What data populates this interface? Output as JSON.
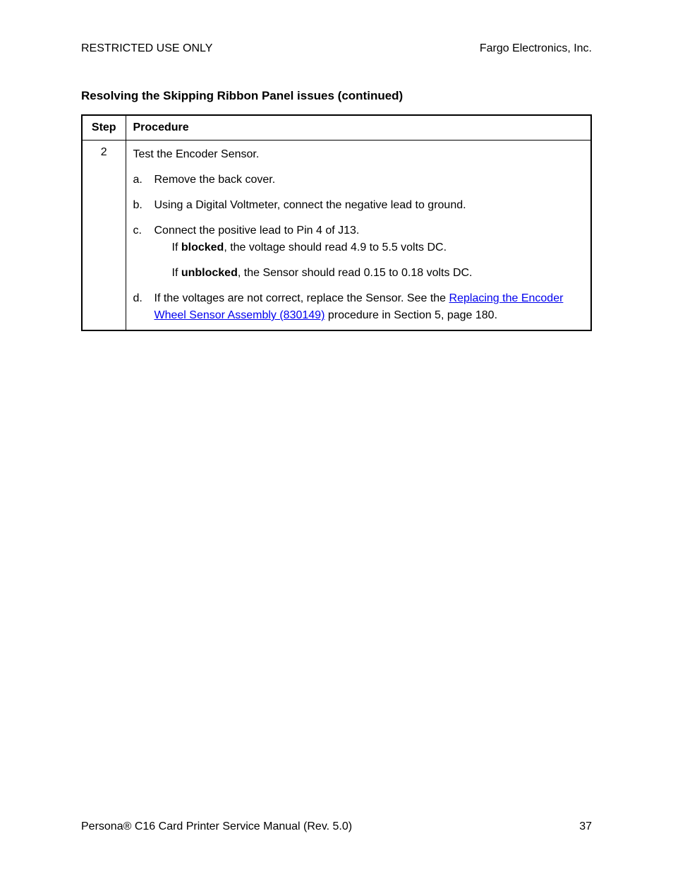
{
  "header": {
    "left": "RESTRICTED USE ONLY",
    "right": "Fargo Electronics, Inc."
  },
  "section_title": "Resolving the Skipping Ribbon Panel issues (continued)",
  "table": {
    "col_step": "Step",
    "col_procedure": "Procedure",
    "step_num": "2",
    "intro": "Test the Encoder Sensor.",
    "a_marker": "a.",
    "a_text": "Remove the back cover.",
    "b_marker": "b.",
    "b_text": "Using a Digital Voltmeter, connect the negative lead to ground.",
    "c_marker": "c.",
    "c_text": "Connect the positive lead to Pin 4 of J13.",
    "c_sub1_pre": "If ",
    "c_sub1_bold": "blocked",
    "c_sub1_post": ", the voltage should read 4.9 to 5.5 volts DC.",
    "c_sub2_pre": "If ",
    "c_sub2_bold": "unblocked",
    "c_sub2_post": ", the Sensor should read 0.15 to 0.18 volts DC.",
    "d_marker": "d.",
    "d_pre": " If the voltages are not correct, replace the Sensor. See the ",
    "d_link": "Replacing the Encoder Wheel Sensor Assembly (830149)",
    "d_post": " procedure in Section 5, page 180."
  },
  "footer": {
    "left_pre": "Persona",
    "reg": "®",
    "left_post": " C16 Card Printer Service Manual (Rev. 5.0)",
    "page": "37"
  }
}
